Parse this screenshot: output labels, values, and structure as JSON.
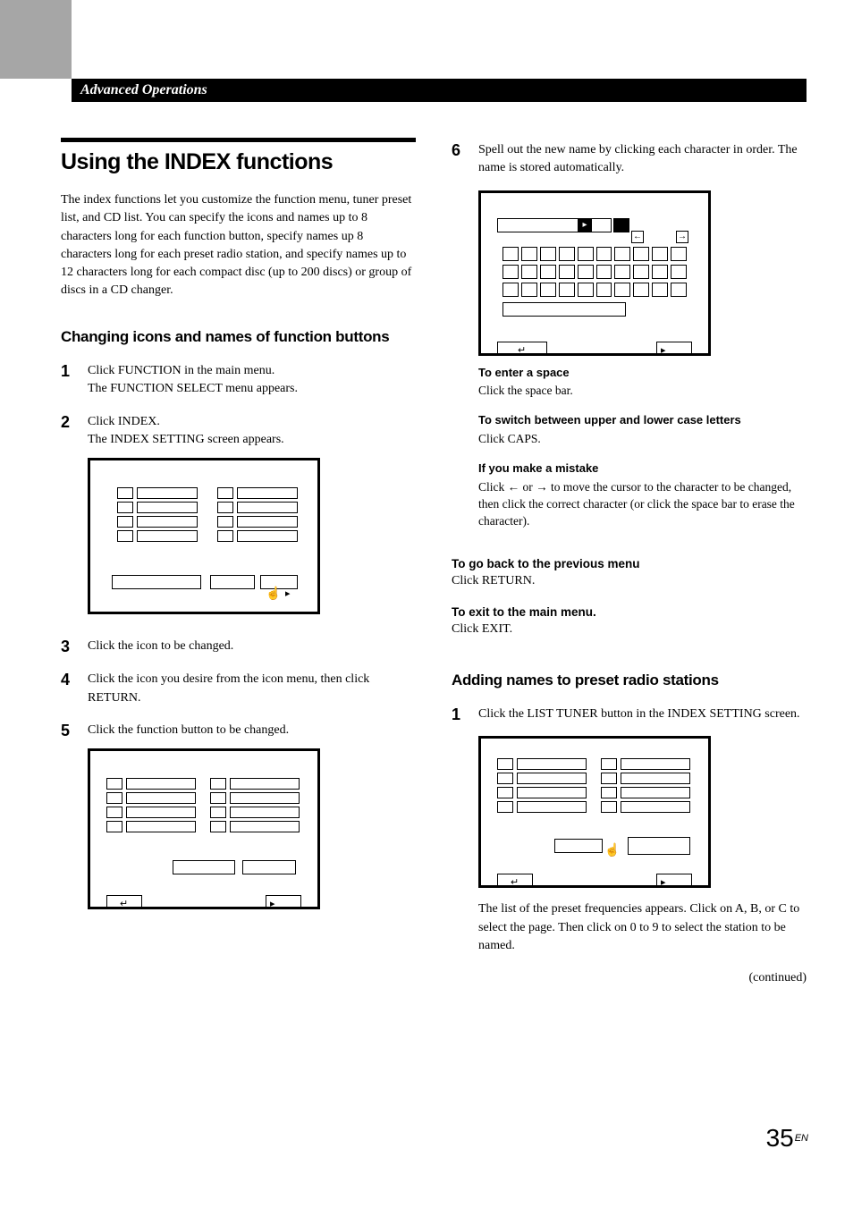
{
  "header": {
    "section": "Advanced Operations"
  },
  "title": "Using the INDEX functions",
  "intro": "The index functions let you customize the function menu, tuner preset list, and CD list. You can specify the icons and names up to 8 characters long for each function button, specify names up 8 characters long for each preset radio station, and specify names up to 12 characters long for each compact disc (up to 200 discs) or group of discs in a CD changer.",
  "sec1": {
    "heading": "Changing icons and names of function buttons",
    "steps": {
      "s1": {
        "n": "1",
        "l1": "Click FUNCTION in the main menu.",
        "l2": "The FUNCTION SELECT menu appears."
      },
      "s2": {
        "n": "2",
        "l1": "Click INDEX.",
        "l2": "The INDEX SETTING screen appears."
      },
      "s3": {
        "n": "3",
        "t": "Click the icon to be changed."
      },
      "s4": {
        "n": "4",
        "t": "Click the icon you desire from the icon menu, then click RETURN."
      },
      "s5": {
        "n": "5",
        "t": "Click the function button to be changed."
      },
      "s6": {
        "n": "6",
        "t": "Spell out the new name by clicking each character in order. The name is stored automatically."
      }
    }
  },
  "tips": {
    "t1": {
      "h": "To enter a space",
      "b": "Click the space bar."
    },
    "t2": {
      "h": "To switch between upper and lower case letters",
      "b": "Click CAPS."
    },
    "t3": {
      "h": "If you make a mistake",
      "pre": "Click ",
      "mid": " or ",
      "post": " to move the cursor to the character to be changed, then click the correct character (or click the space bar to erase the character)."
    }
  },
  "notes": {
    "n1": {
      "h": "To go back to the previous menu",
      "b": "Click RETURN."
    },
    "n2": {
      "h": "To exit to the main menu.",
      "b": " Click EXIT."
    }
  },
  "sec2": {
    "heading": "Adding names to preset radio stations",
    "steps": {
      "s1": {
        "n": "1",
        "t": "Click the LIST TUNER button in the INDEX SETTING screen.",
        "after": "The list of the preset frequencies appears.  Click on A, B, or C to select the page.  Then click on 0 to 9 to select the station to be named."
      }
    }
  },
  "continued": "(continued)",
  "page": {
    "num": "35",
    "suffix": "EN"
  },
  "glyphs": {
    "left": "←",
    "right": "→",
    "play": "▸",
    "return": "↵",
    "exit": "↪",
    "hand": "☞"
  }
}
